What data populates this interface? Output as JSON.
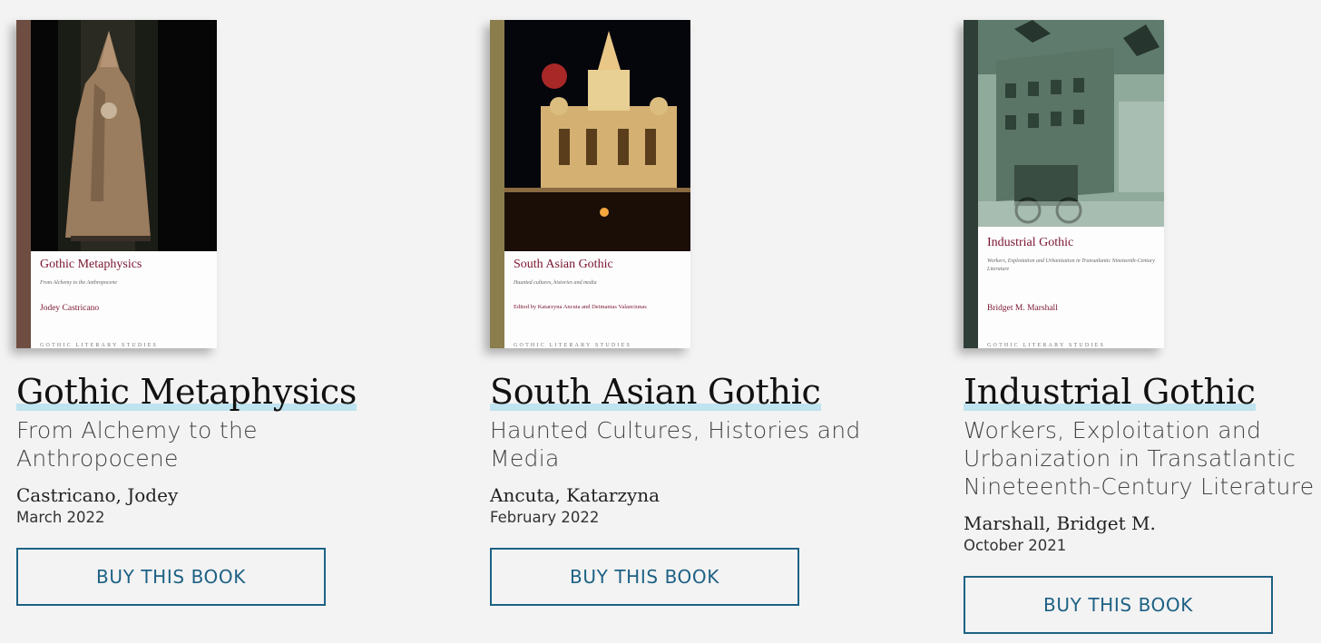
{
  "books": [
    {
      "cover": {
        "title": "Gothic Metaphysics",
        "subtitle": "From Alchemy to the Anthropocene",
        "author": "Jodey Castricano",
        "series": "GOTHIC LITERARY STUDIES",
        "spine_color": "#6e4e42"
      },
      "title": "Gothic Metaphysics",
      "subtitle": "From Alchemy to the Anthropocene",
      "author": "Castricano, Jodey",
      "date": "March 2022",
      "buy_label": "BUY THIS BOOK"
    },
    {
      "cover": {
        "title": "South Asian Gothic",
        "subtitle": "Haunted cultures, histories and media",
        "author": "Edited by Katarzyna Ancuta and Deimantas Valanciunas",
        "series": "GOTHIC LITERARY STUDIES",
        "spine_color": "#8b7d4c"
      },
      "title": "South Asian Gothic",
      "subtitle": "Haunted Cultures, Histories and Media",
      "author": "Ancuta, Katarzyna",
      "date": "February 2022",
      "buy_label": "BUY THIS BOOK"
    },
    {
      "cover": {
        "title": "Industrial Gothic",
        "subtitle": "Workers, Exploitation and Urbanization in Transatlantic Nineteenth-Century Literature",
        "author": "Bridget M. Marshall",
        "series": "GOTHIC LITERARY STUDIES",
        "spine_color": "#2f3f37"
      },
      "title": "Industrial Gothic",
      "subtitle": "Workers, Exploitation and Urbanization in Transatlantic Nineteenth-Century Literature",
      "author": "Marshall, Bridget M.",
      "date": "October 2021",
      "buy_label": "BUY THIS BOOK"
    }
  ],
  "colors": {
    "background": "#f3f3f3",
    "accent": "#1d6184",
    "title_underline": "#bfe3ef",
    "cover_title": "#7a1530"
  }
}
